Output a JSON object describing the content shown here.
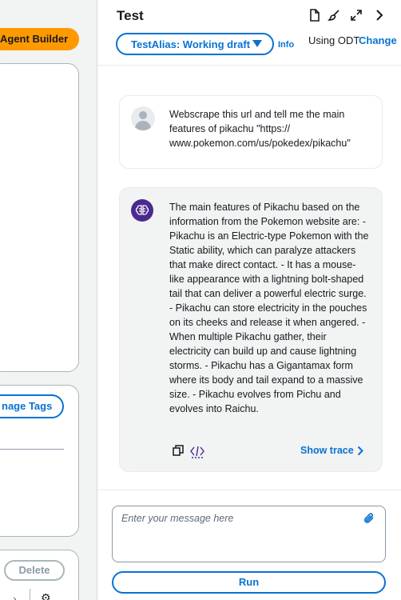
{
  "left_panel": {
    "agent_builder_label": "Agent Builder",
    "manage_tags_label": "nage Tags",
    "delete_label": "Delete"
  },
  "test_panel": {
    "title": "Test",
    "alias_select_value": "TestAlias: Working draft",
    "info_label": "Info",
    "odt_label": "Using ODT",
    "change_label": "Change"
  },
  "messages": [
    {
      "role": "user",
      "text": "Webscrape this url and tell me the main features of pikachu \"https:// www.pokemon.com/us/pokedex/pikachu\""
    },
    {
      "role": "agent",
      "text": "The main features of Pikachu based on the information from the Pokemon website are: - Pikachu is an Electric-type Pokemon with the Static ability, which can paralyze attackers that make direct contact. - It has a mouse-like appearance with a lightning bolt-shaped tail that can deliver a powerful electric surge. - Pikachu can store electricity in the pouches on its cheeks and release it when angered. - When multiple Pikachu gather, their electricity can build up and cause lightning storms. - Pikachu has a Gigantamax form where its body and tail expand to a massive size. - Pikachu evolves from Pichu and evolves into Raichu.",
      "show_trace_label": "Show trace"
    }
  ],
  "composer": {
    "placeholder": "Enter your message here",
    "value": "",
    "run_label": "Run"
  },
  "colors": {
    "accent": "#0972d3",
    "agent_builder_bg": "#ff9900",
    "agent_avatar": "#4b2a8f"
  }
}
